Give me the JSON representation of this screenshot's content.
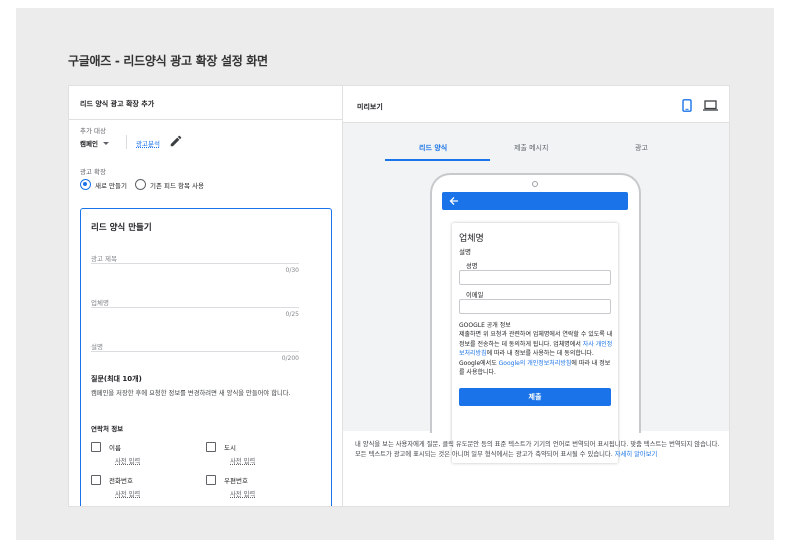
{
  "caption": "구글애즈 - 리드양식 광고 확장 설정 화면",
  "left": {
    "title": "리드 양식 광고 확장 추가",
    "target_label": "추가 대상",
    "campaign_type": "캠페인",
    "campaign_name": "광고분석",
    "extension_label": "광고 확장",
    "radio_new": "새로 만들기",
    "radio_existing": "기존 피드 항목 사용",
    "radio_selected": "새로 만들기",
    "card": {
      "title": "리드 양식 만들기",
      "headline_label": "광고 제목",
      "headline_counter": "0/30",
      "business_label": "업체명",
      "business_counter": "0/25",
      "description_label": "설명",
      "description_counter": "0/200",
      "questions_title": "질문(최대 10개)",
      "questions_desc": "캠페인을 저장한 후에 요청한 정보를 변경하려면 새 양식을 만들어야 합니다.",
      "contact_title": "연락처 정보",
      "items": [
        {
          "label": "이름",
          "sub": "사전 입력"
        },
        {
          "label": "도시",
          "sub": "사전 입력"
        },
        {
          "label": "전화번호",
          "sub": "사전 입력"
        },
        {
          "label": "우편번호",
          "sub": "사전 입력"
        }
      ]
    }
  },
  "right": {
    "title": "미리보기",
    "tabs": [
      "리드 양식",
      "제출 메시지",
      "광고"
    ],
    "active_tab": "리드 양식",
    "form": {
      "business_name": "업체명",
      "description": "설명",
      "name_label": "성명",
      "email_label": "이메일",
      "google_title": "GOOGLE 공개 정보",
      "google_text_1": "제출하면 위 요청과 관련하여 업체명에서 연락할 수 있도록 내 정보를 전송하는 데 동의하게 됩니다. 업체명에서 ",
      "google_link_1": "자사 개인정보처리방침",
      "google_text_2": "에 따라 내 정보를 사용하는 데 동의합니다. Google에서도 ",
      "google_link_2": "Google의 개인정보처리방침",
      "google_text_3": "에 따라 내 정보를 사용합니다.",
      "submit": "제출"
    },
    "notice_text": "내 양식을 보는 사용자에게 질문, 클릭 유도문안 등의 표준 텍스트가 기기의 언어로 번역되어 표시됩니다. 맞춤 텍스트는 번역되지 않습니다. 모든 텍스트가 광고에 표시되는 것은 아니며 일부 형식에서는 광고가 축약되어 표시될 수 있습니다. ",
    "notice_link": "자세히 알아보기"
  },
  "colors": {
    "accent": "#1a73e8",
    "background": "#ececec"
  },
  "icons": [
    "pencil-icon",
    "mobile-device-icon",
    "laptop-device-icon",
    "back-arrow-icon"
  ]
}
